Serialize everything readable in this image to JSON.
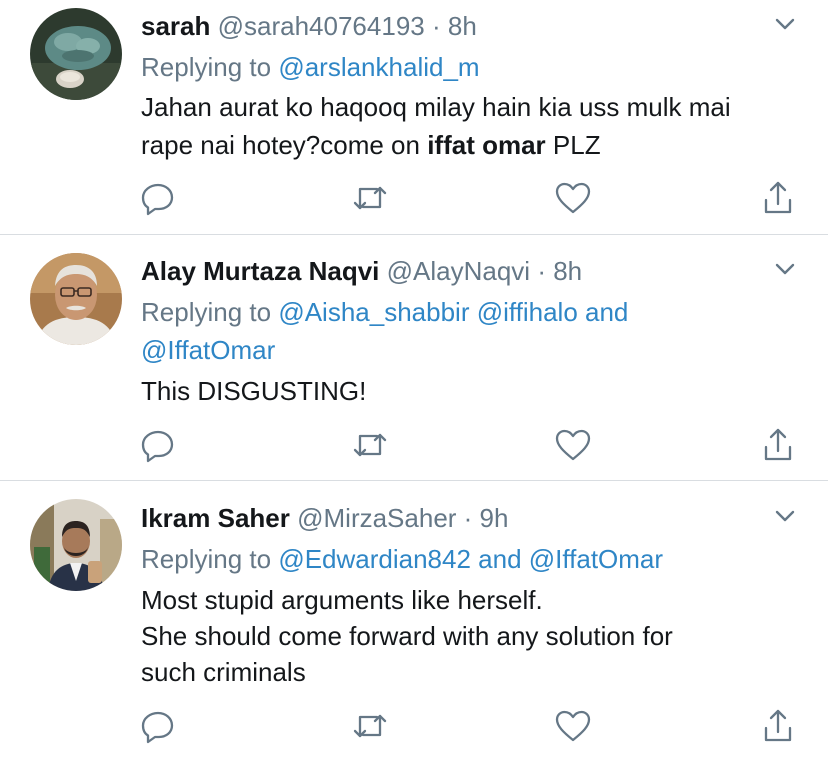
{
  "colors": {
    "link": "#2f86c6",
    "meta": "#657786",
    "text": "#14171a",
    "icon": "#657786",
    "divider": "#d9dde1"
  },
  "icons": {
    "reply": "reply-icon",
    "retweet": "retweet-icon",
    "like": "heart-icon",
    "share": "share-icon",
    "more": "chevron-down-icon"
  },
  "tweets": [
    {
      "name": "sarah",
      "handle": "@sarah40764193",
      "sep": " · ",
      "time": "8h",
      "replying_prefix": "Replying to ",
      "mention_line1": "@arslankhalid_m",
      "mention_line2": "",
      "text_line1": "Jahan aurat ko haqooq milay hain kia uss mulk mai",
      "text_line2_pre": "rape nai hotey?come on ",
      "text_line2_bold": "iffat omar",
      "text_line2_post": " PLZ"
    },
    {
      "name": "Alay Murtaza Naqvi",
      "handle": "@AlayNaqvi",
      "sep": " · ",
      "time": "8h",
      "replying_prefix": "Replying to ",
      "mention_line1": "@Aisha_shabbir @iffihalo and",
      "mention_line2": "@IffatOmar",
      "text_line1": "This DISGUSTING!"
    },
    {
      "name": "Ikram Saher",
      "handle": "@MirzaSaher",
      "sep": " · ",
      "time": "9h",
      "replying_prefix": "Replying to ",
      "mention_line1": "@Edwardian842 and @IffatOmar",
      "text_line1": "Most stupid arguments like herself.",
      "text_line2": "She should come forward with any solution for",
      "text_line3": "such criminals"
    }
  ]
}
